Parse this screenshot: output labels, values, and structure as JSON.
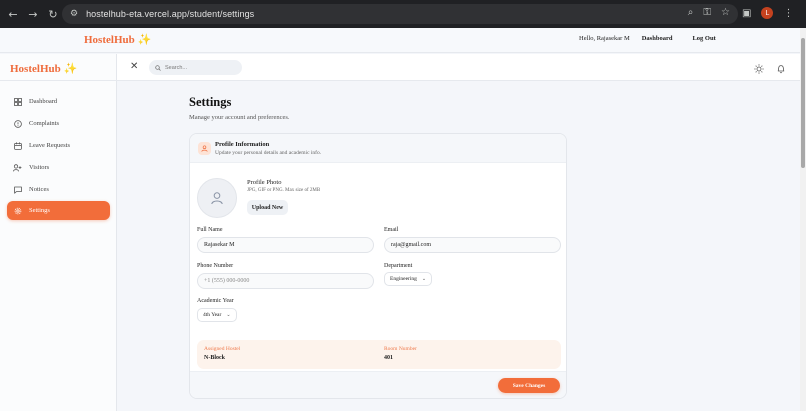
{
  "browser": {
    "url": "hostelhub-eta.vercel.app/student/settings",
    "profile_initial": "L"
  },
  "topnav": {
    "brand": "HostelHub",
    "sparkle": "✨",
    "greeting": "Hello, Rajasekar M",
    "dashboard_link": "Dashboard",
    "logout_link": "Log Out"
  },
  "sidebar": {
    "brand": "HostelHub",
    "sparkle": "✨",
    "items": [
      {
        "label": "Dashboard",
        "icon": "grid-icon"
      },
      {
        "label": "Complaints",
        "icon": "alert-circle-icon"
      },
      {
        "label": "Leave Requests",
        "icon": "calendar-icon"
      },
      {
        "label": "Visitors",
        "icon": "user-plus-icon"
      },
      {
        "label": "Notices",
        "icon": "message-square-icon"
      },
      {
        "label": "Settings",
        "icon": "gear-icon",
        "active": true
      }
    ]
  },
  "header": {
    "search_placeholder": "Search..."
  },
  "main": {
    "title": "Settings",
    "subtitle": "Manage your account and preferences.",
    "profile": {
      "title": "Profile Information",
      "subtitle": "Update your personal details and academic info.",
      "photo_title": "Profile Photo",
      "photo_hint": "JPG, GIF or PNG. Max size of 2MB",
      "upload_label": "Upload New",
      "full_name_label": "Full Name",
      "full_name_value": "Rajasekar M",
      "email_label": "Email",
      "email_value": "raja@gmail.com",
      "phone_label": "Phone Number",
      "phone_placeholder": "+1 (555) 000-0000",
      "department_label": "Department",
      "department_value": "Engineering",
      "year_label": "Academic Year",
      "year_value": "4th Year",
      "hostel_label": "Assigned Hostel",
      "hostel_value": "N-Block",
      "room_label": "Room Number",
      "room_value": "401",
      "save_label": "Save Changes"
    }
  },
  "colors": {
    "accent": "#f26d3a",
    "brand": "#ef6c3c"
  }
}
